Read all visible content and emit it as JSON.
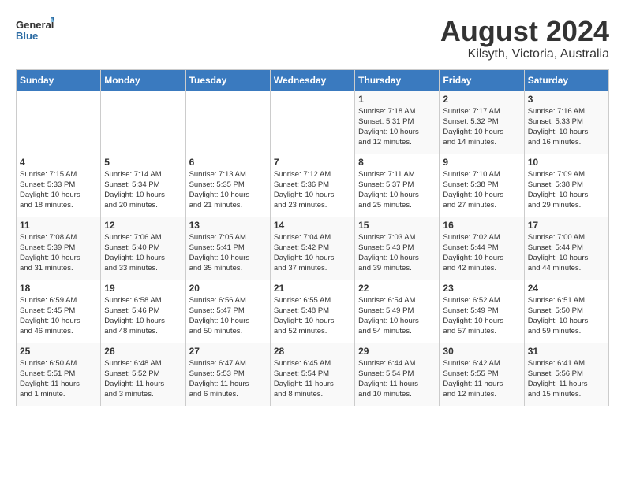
{
  "logo": {
    "general": "General",
    "blue": "Blue"
  },
  "title": {
    "month_year": "August 2024",
    "location": "Kilsyth, Victoria, Australia"
  },
  "days_of_week": [
    "Sunday",
    "Monday",
    "Tuesday",
    "Wednesday",
    "Thursday",
    "Friday",
    "Saturday"
  ],
  "weeks": [
    [
      {
        "day": "",
        "info": ""
      },
      {
        "day": "",
        "info": ""
      },
      {
        "day": "",
        "info": ""
      },
      {
        "day": "",
        "info": ""
      },
      {
        "day": "1",
        "info": "Sunrise: 7:18 AM\nSunset: 5:31 PM\nDaylight: 10 hours\nand 12 minutes."
      },
      {
        "day": "2",
        "info": "Sunrise: 7:17 AM\nSunset: 5:32 PM\nDaylight: 10 hours\nand 14 minutes."
      },
      {
        "day": "3",
        "info": "Sunrise: 7:16 AM\nSunset: 5:33 PM\nDaylight: 10 hours\nand 16 minutes."
      }
    ],
    [
      {
        "day": "4",
        "info": "Sunrise: 7:15 AM\nSunset: 5:33 PM\nDaylight: 10 hours\nand 18 minutes."
      },
      {
        "day": "5",
        "info": "Sunrise: 7:14 AM\nSunset: 5:34 PM\nDaylight: 10 hours\nand 20 minutes."
      },
      {
        "day": "6",
        "info": "Sunrise: 7:13 AM\nSunset: 5:35 PM\nDaylight: 10 hours\nand 21 minutes."
      },
      {
        "day": "7",
        "info": "Sunrise: 7:12 AM\nSunset: 5:36 PM\nDaylight: 10 hours\nand 23 minutes."
      },
      {
        "day": "8",
        "info": "Sunrise: 7:11 AM\nSunset: 5:37 PM\nDaylight: 10 hours\nand 25 minutes."
      },
      {
        "day": "9",
        "info": "Sunrise: 7:10 AM\nSunset: 5:38 PM\nDaylight: 10 hours\nand 27 minutes."
      },
      {
        "day": "10",
        "info": "Sunrise: 7:09 AM\nSunset: 5:38 PM\nDaylight: 10 hours\nand 29 minutes."
      }
    ],
    [
      {
        "day": "11",
        "info": "Sunrise: 7:08 AM\nSunset: 5:39 PM\nDaylight: 10 hours\nand 31 minutes."
      },
      {
        "day": "12",
        "info": "Sunrise: 7:06 AM\nSunset: 5:40 PM\nDaylight: 10 hours\nand 33 minutes."
      },
      {
        "day": "13",
        "info": "Sunrise: 7:05 AM\nSunset: 5:41 PM\nDaylight: 10 hours\nand 35 minutes."
      },
      {
        "day": "14",
        "info": "Sunrise: 7:04 AM\nSunset: 5:42 PM\nDaylight: 10 hours\nand 37 minutes."
      },
      {
        "day": "15",
        "info": "Sunrise: 7:03 AM\nSunset: 5:43 PM\nDaylight: 10 hours\nand 39 minutes."
      },
      {
        "day": "16",
        "info": "Sunrise: 7:02 AM\nSunset: 5:44 PM\nDaylight: 10 hours\nand 42 minutes."
      },
      {
        "day": "17",
        "info": "Sunrise: 7:00 AM\nSunset: 5:44 PM\nDaylight: 10 hours\nand 44 minutes."
      }
    ],
    [
      {
        "day": "18",
        "info": "Sunrise: 6:59 AM\nSunset: 5:45 PM\nDaylight: 10 hours\nand 46 minutes."
      },
      {
        "day": "19",
        "info": "Sunrise: 6:58 AM\nSunset: 5:46 PM\nDaylight: 10 hours\nand 48 minutes."
      },
      {
        "day": "20",
        "info": "Sunrise: 6:56 AM\nSunset: 5:47 PM\nDaylight: 10 hours\nand 50 minutes."
      },
      {
        "day": "21",
        "info": "Sunrise: 6:55 AM\nSunset: 5:48 PM\nDaylight: 10 hours\nand 52 minutes."
      },
      {
        "day": "22",
        "info": "Sunrise: 6:54 AM\nSunset: 5:49 PM\nDaylight: 10 hours\nand 54 minutes."
      },
      {
        "day": "23",
        "info": "Sunrise: 6:52 AM\nSunset: 5:49 PM\nDaylight: 10 hours\nand 57 minutes."
      },
      {
        "day": "24",
        "info": "Sunrise: 6:51 AM\nSunset: 5:50 PM\nDaylight: 10 hours\nand 59 minutes."
      }
    ],
    [
      {
        "day": "25",
        "info": "Sunrise: 6:50 AM\nSunset: 5:51 PM\nDaylight: 11 hours\nand 1 minute."
      },
      {
        "day": "26",
        "info": "Sunrise: 6:48 AM\nSunset: 5:52 PM\nDaylight: 11 hours\nand 3 minutes."
      },
      {
        "day": "27",
        "info": "Sunrise: 6:47 AM\nSunset: 5:53 PM\nDaylight: 11 hours\nand 6 minutes."
      },
      {
        "day": "28",
        "info": "Sunrise: 6:45 AM\nSunset: 5:54 PM\nDaylight: 11 hours\nand 8 minutes."
      },
      {
        "day": "29",
        "info": "Sunrise: 6:44 AM\nSunset: 5:54 PM\nDaylight: 11 hours\nand 10 minutes."
      },
      {
        "day": "30",
        "info": "Sunrise: 6:42 AM\nSunset: 5:55 PM\nDaylight: 11 hours\nand 12 minutes."
      },
      {
        "day": "31",
        "info": "Sunrise: 6:41 AM\nSunset: 5:56 PM\nDaylight: 11 hours\nand 15 minutes."
      }
    ]
  ]
}
